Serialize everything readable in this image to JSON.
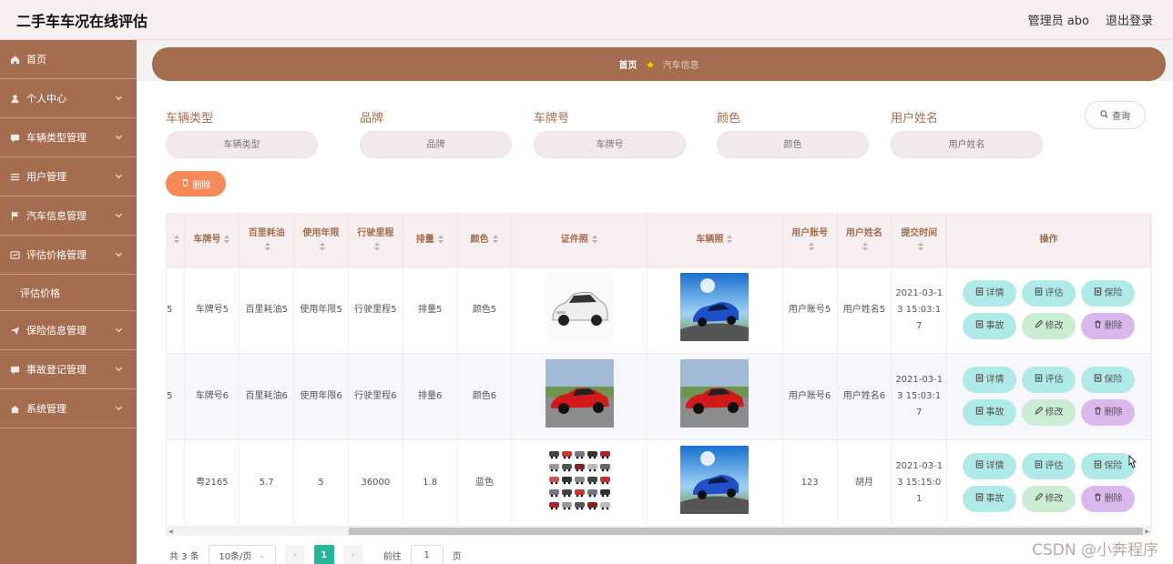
{
  "header": {
    "title": "二手车车况在线评估",
    "user": "管理员 abo",
    "logout": "退出登录"
  },
  "sidebar": {
    "items": [
      {
        "label": "首页",
        "icon": "home-icon",
        "has_children": false
      },
      {
        "label": "个人中心",
        "icon": "user-icon",
        "has_children": true
      },
      {
        "label": "车辆类型管理",
        "icon": "chat-icon",
        "has_children": true
      },
      {
        "label": "用户管理",
        "icon": "list-icon",
        "has_children": true
      },
      {
        "label": "汽车信息管理",
        "icon": "flag-icon",
        "has_children": true
      },
      {
        "label": "评估价格管理",
        "icon": "board-icon",
        "has_children": true
      },
      {
        "label": "保险信息管理",
        "icon": "send-icon",
        "has_children": true
      },
      {
        "label": "事故登记管理",
        "icon": "chat-icon",
        "has_children": true
      },
      {
        "label": "系统管理",
        "icon": "house-icon",
        "has_children": true
      }
    ],
    "sub_item": "评估价格"
  },
  "breadcrumb": {
    "home": "首页",
    "current": "汽车信息"
  },
  "filters": [
    {
      "label": "车辆类型",
      "placeholder": "车辆类型"
    },
    {
      "label": "品牌",
      "placeholder": "品牌"
    },
    {
      "label": "车牌号",
      "placeholder": "车牌号"
    },
    {
      "label": "颜色",
      "placeholder": "颜色"
    },
    {
      "label": "用户姓名",
      "placeholder": "用户姓名"
    }
  ],
  "buttons": {
    "query": "查询",
    "delete": "删除"
  },
  "table": {
    "columns": [
      "车牌号",
      "百里耗油",
      "使用年限",
      "行驶里程",
      "排量",
      "颜色",
      "证件照",
      "车辆照",
      "用户账号",
      "用户姓名",
      "提交时间",
      "操作"
    ],
    "rows": [
      {
        "cut": "5",
        "plate": "车牌号5",
        "fuel": "百里耗油5",
        "years": "使用年限5",
        "mileage": "行驶里程5",
        "disp": "排量5",
        "color": "颜色5",
        "account": "用户账号5",
        "name": "用户姓名5",
        "time": "2021-03-13 15:03:17",
        "img1": "white-car",
        "img2": "blue-car"
      },
      {
        "cut": "5",
        "plate": "车牌号6",
        "fuel": "百里耗油6",
        "years": "使用年限6",
        "mileage": "行驶里程6",
        "disp": "排量6",
        "color": "颜色6",
        "account": "用户账号6",
        "name": "用户姓名6",
        "time": "2021-03-13 15:03:17",
        "img1": "red-car",
        "img2": "red-car"
      },
      {
        "cut": "",
        "plate": "粤2165",
        "fuel": "5.7",
        "years": "5",
        "mileage": "36000",
        "disp": "1.8",
        "color": "蓝色",
        "account": "123",
        "name": "胡月",
        "time": "2021-03-13 15:15:01",
        "img1": "car-grid",
        "img2": "blue-car"
      }
    ],
    "actions": [
      "详情",
      "评估",
      "保险",
      "事故",
      "修改",
      "删除"
    ]
  },
  "pagination": {
    "total": "共 3 条",
    "page_size": "10条/页",
    "current": "1",
    "goto_label": "前往",
    "goto_value": "1",
    "page_suffix": "页"
  },
  "watermark": "CSDN @小奔程序",
  "colors": {
    "brand": "#a46d50",
    "delete": "#f58957",
    "cyan": "#afeae8",
    "green": "#c9ecd3",
    "purple": "#d9b9ec",
    "page_active": "#23b79a"
  }
}
